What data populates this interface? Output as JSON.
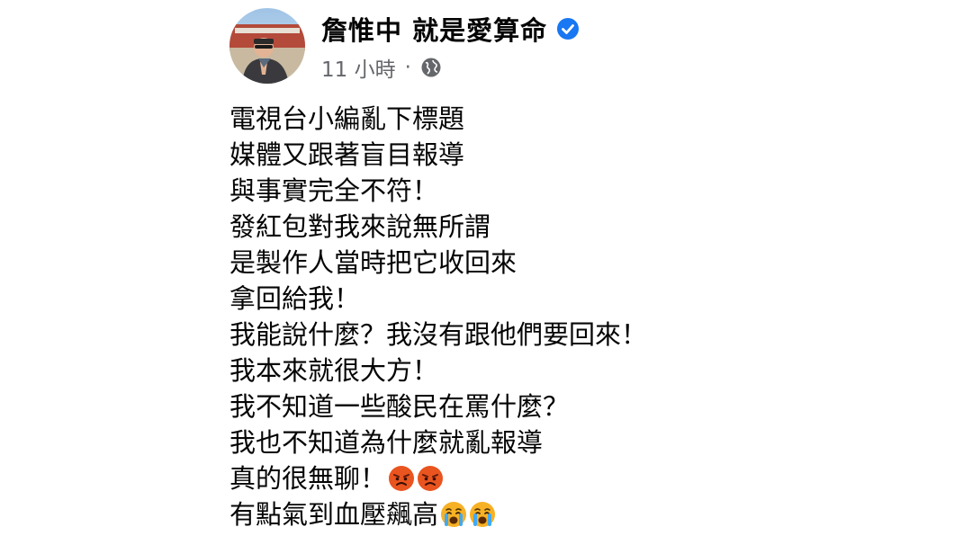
{
  "post": {
    "author": "詹惟中 就是愛算命",
    "verified": true,
    "timestamp": "11 小時",
    "separator": "·",
    "audience_icon": "globe-icon",
    "lines": [
      "電視台小編亂下標題",
      "媒體又跟著盲目報導",
      "與事實完全不符！",
      "發紅包對我來說無所謂",
      "是製作人當時把它收回來",
      "拿回給我！",
      "我能說什麼？我沒有跟他們要回來！",
      "我本來就很大方！",
      "我不知道一些酸民在罵什麼？",
      "我也不知道為什麼就亂報導",
      "真的很無聊！",
      "有點氣到血壓飆高"
    ],
    "line_emojis": {
      "10": [
        "angry-face-emoji",
        "angry-face-emoji"
      ],
      "11": [
        "crying-face-emoji",
        "crying-face-emoji"
      ]
    }
  },
  "colors": {
    "verified_badge": "#1877f2",
    "secondary_text": "#65676b",
    "angry_emoji": "#e9541f",
    "crying_emoji": "#f7b125"
  }
}
